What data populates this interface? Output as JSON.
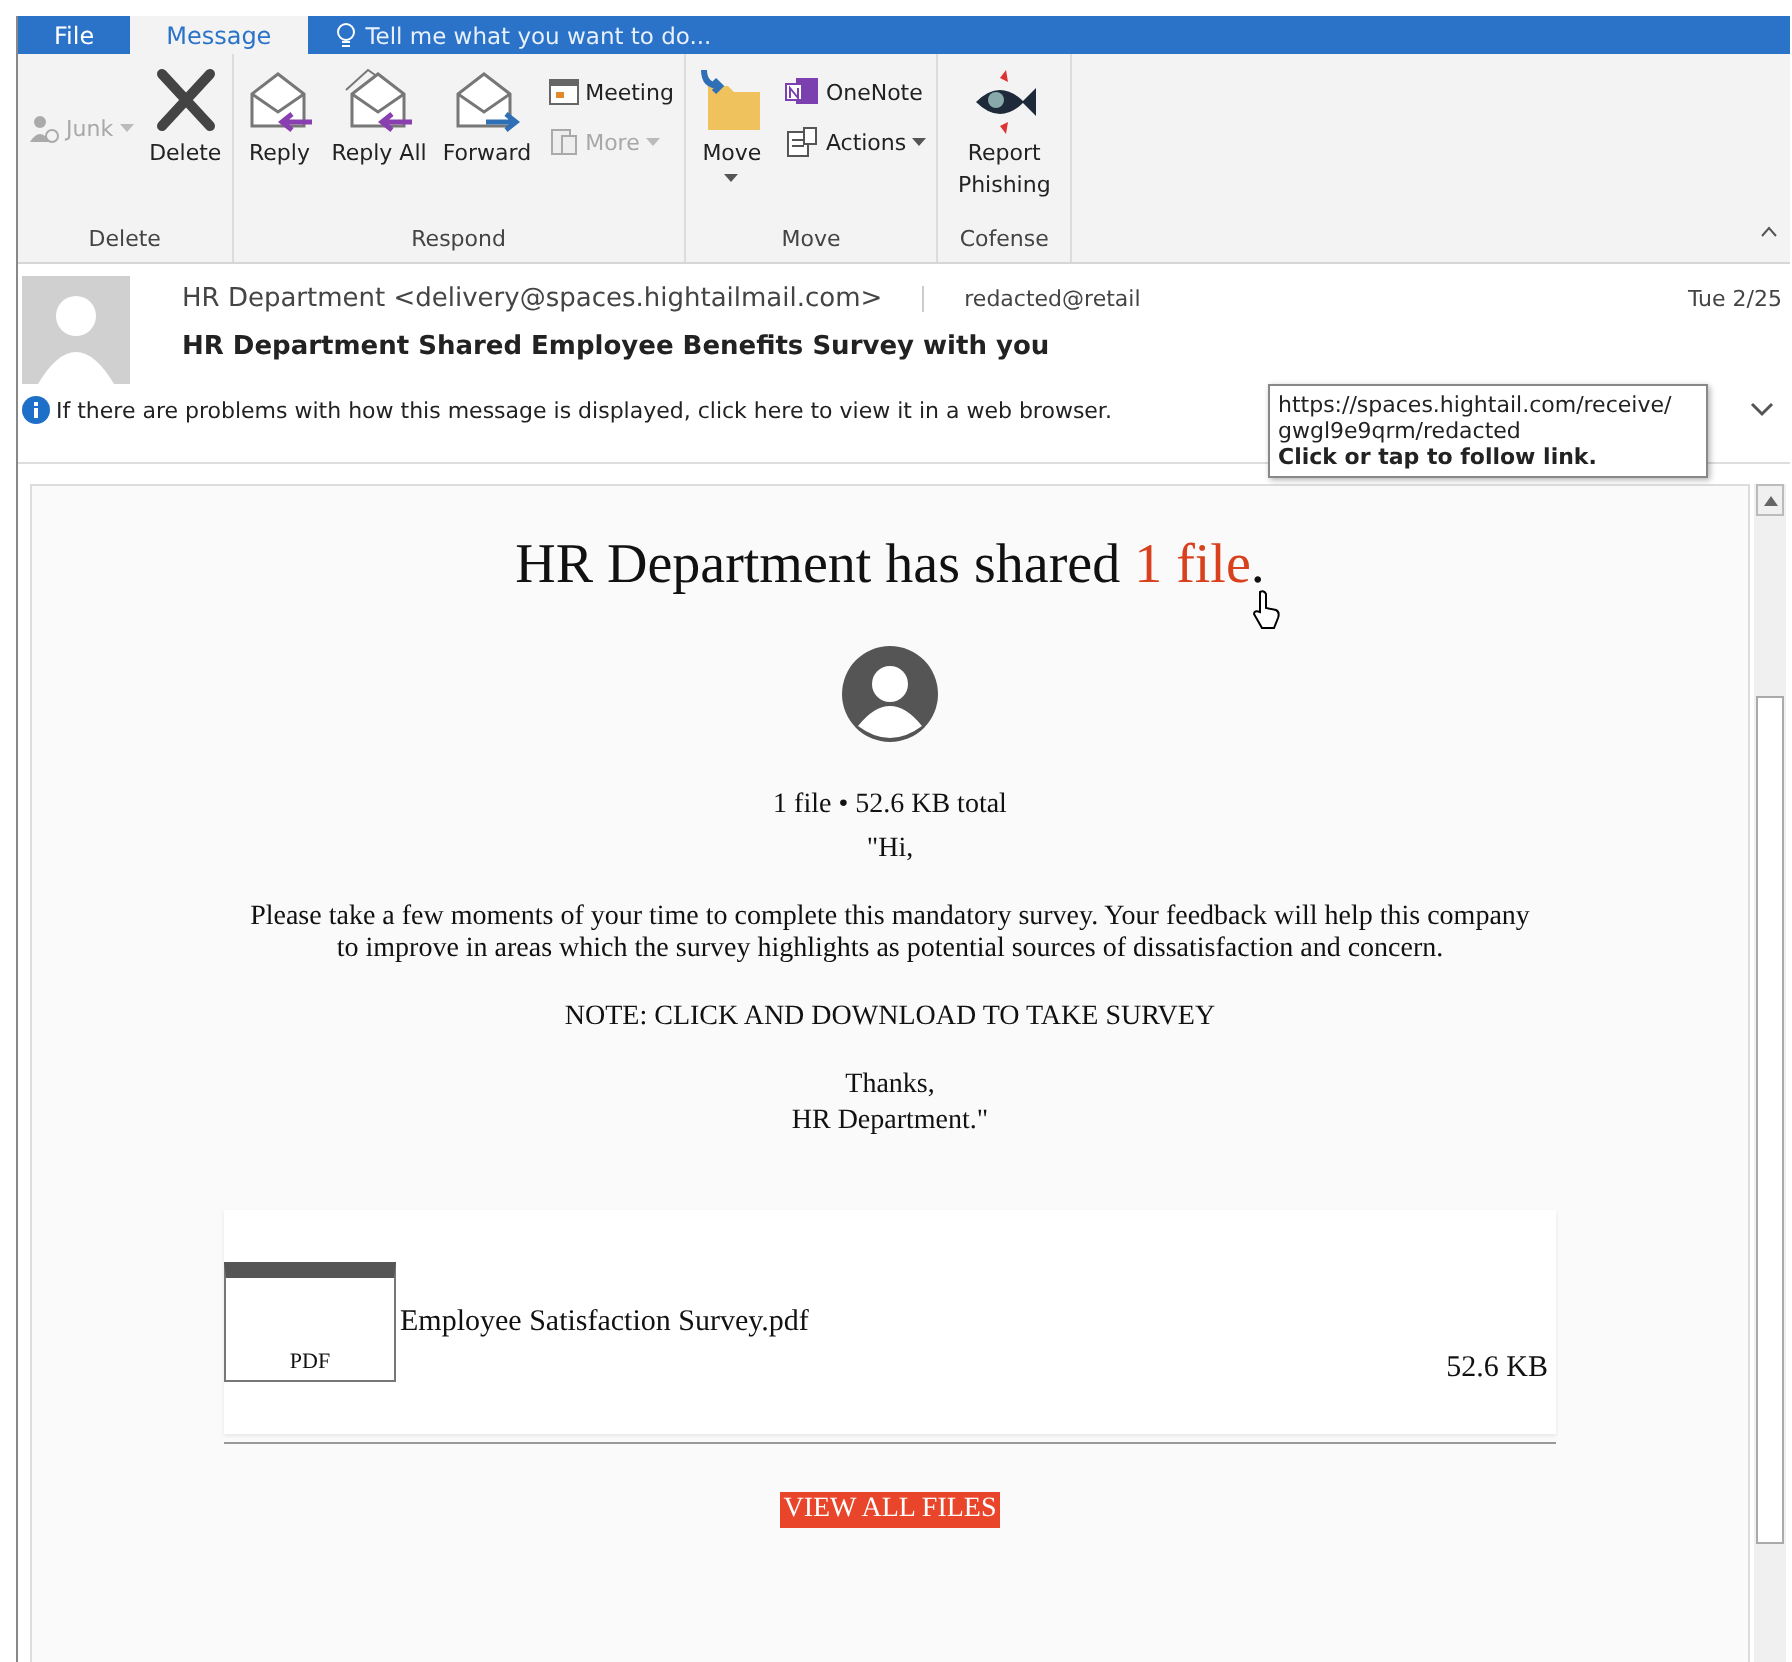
{
  "tabs": [
    {
      "label": "File",
      "selected": false
    },
    {
      "label": "Message",
      "selected": true
    }
  ],
  "tell_me": {
    "placeholder": "Tell me what you want to do..."
  },
  "ribbon": {
    "groups": [
      {
        "label": "Delete",
        "buttons": [
          {
            "label": "Junk",
            "kind": "small",
            "disabled": true,
            "dropdown": true
          },
          {
            "label": "Delete",
            "kind": "large",
            "disabled": false,
            "dropdown": false
          }
        ]
      },
      {
        "label": "Respond",
        "buttons": [
          {
            "label": "Reply",
            "kind": "large",
            "disabled": false,
            "dropdown": false
          },
          {
            "label": "Reply All",
            "kind": "large",
            "disabled": false,
            "dropdown": false
          },
          {
            "label": "Forward",
            "kind": "large",
            "disabled": false,
            "dropdown": false
          },
          {
            "label": "Meeting",
            "kind": "small",
            "disabled": false,
            "dropdown": false
          },
          {
            "label": "More",
            "kind": "small",
            "disabled": true,
            "dropdown": true
          }
        ]
      },
      {
        "label": "Move",
        "buttons": [
          {
            "label": "Move",
            "kind": "large",
            "disabled": false,
            "dropdown": true
          },
          {
            "label": "OneNote",
            "kind": "small",
            "disabled": false,
            "dropdown": false
          },
          {
            "label": "Actions",
            "kind": "small",
            "disabled": false,
            "dropdown": true
          }
        ]
      },
      {
        "label": "Cofense",
        "buttons": [
          {
            "label": "Report Phishing",
            "kind": "large",
            "disabled": false,
            "dropdown": false
          }
        ]
      }
    ]
  },
  "message": {
    "sender": "HR Department <delivery@spaces.hightailmail.com>",
    "recipient": "redacted@retail",
    "date": "Tue 2/25",
    "subject": "HR Department Shared Employee Benefits Survey with you",
    "info": "If there are problems with how this message is displayed, click here to view it in a web browser.",
    "tooltip": {
      "url": "https://spaces.hightail.com/receive/ gwgl9e9qrm/redacted",
      "hint": "Click or tap to follow link."
    }
  },
  "body": {
    "heading": "HR Department has shared ",
    "heading_link": "1 file",
    "heading_end": ".",
    "summary": "1 file • 52.6 KB total",
    "greeting": "\"Hi,",
    "paragraph": "Please take a few moments of your time to complete this mandatory survey. Your feedback will help this company to improve in areas which the survey highlights as potential sources of dissatisfaction and concern.",
    "note": "NOTE: CLICK AND DOWNLOAD TO TAKE SURVEY",
    "thanks": "Thanks,",
    "signoff": "HR Department.\"",
    "attachment": {
      "name": "Employee Satisfaction Survey.pdf",
      "type": "PDF",
      "size": "52.6 KB"
    },
    "button": "VIEW ALL FILES"
  }
}
